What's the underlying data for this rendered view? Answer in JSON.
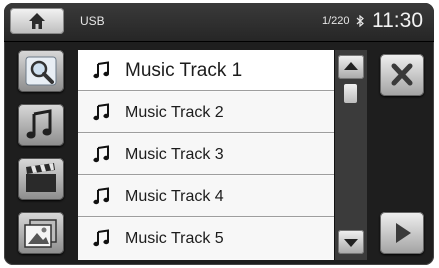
{
  "status_bar": {
    "source": "USB",
    "track_count": "1/220",
    "bluetooth_icon": "bluetooth-icon",
    "clock": "11:30"
  },
  "sidebar": {
    "items": [
      {
        "name": "search",
        "icon": "search-icon"
      },
      {
        "name": "music",
        "icon": "music-note-icon"
      },
      {
        "name": "video",
        "icon": "clapperboard-icon"
      },
      {
        "name": "photo",
        "icon": "photo-icon"
      }
    ]
  },
  "tracks": [
    {
      "title": "Music Track 1",
      "selected": true
    },
    {
      "title": "Music Track 2"
    },
    {
      "title": "Music Track 3"
    },
    {
      "title": "Music Track 4"
    },
    {
      "title": "Music Track 5"
    }
  ],
  "controls": {
    "close_icon": "close-icon",
    "play_icon": "play-icon",
    "scroll_up_icon": "up-arrow-icon",
    "scroll_down_icon": "down-arrow-icon"
  }
}
